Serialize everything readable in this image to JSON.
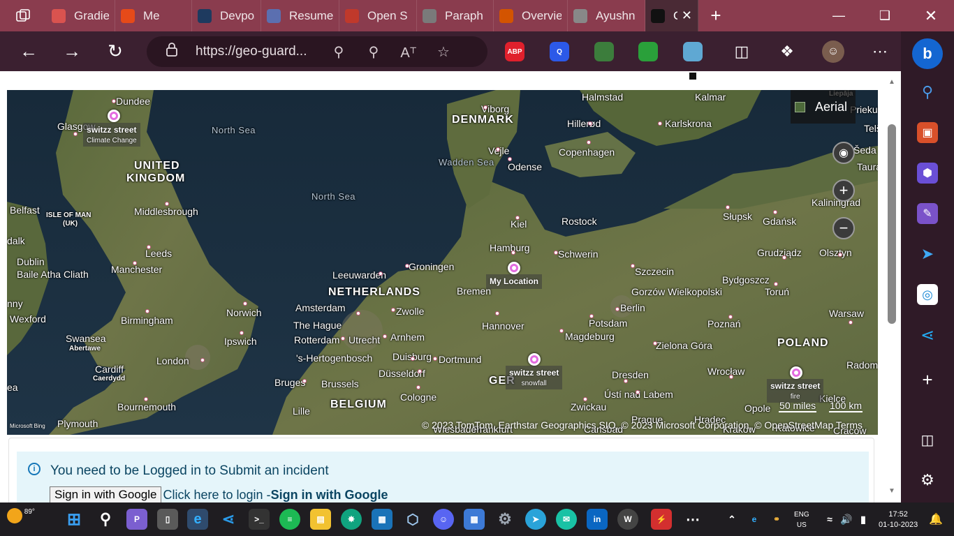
{
  "browser": {
    "tabs": [
      {
        "title": "Gradien",
        "color": "#d9534f"
      },
      {
        "title": "Me",
        "color": "#e64a19"
      },
      {
        "title": "Devpos",
        "color": "#1e3a5f"
      },
      {
        "title": "Resume",
        "color": "#5b6fb0"
      },
      {
        "title": "Open S",
        "color": "#c0392b"
      },
      {
        "title": "Paraph",
        "color": "#7a7a7a"
      },
      {
        "title": "Overvie",
        "color": "#d35400"
      },
      {
        "title": "Ayushn",
        "color": "#888888"
      },
      {
        "title": "Cre",
        "color": "#111111",
        "active": true
      }
    ],
    "address": {
      "url": "https://geo-guard..."
    },
    "extensions": [
      {
        "label": "ABP",
        "color": "#e0202c"
      },
      {
        "label": "Q",
        "color": "#2c59e8"
      },
      {
        "label": "",
        "color": "#3c7d3c"
      },
      {
        "label": "",
        "color": "#2aa03a"
      },
      {
        "label": "",
        "color": "#5fa8d3"
      }
    ]
  },
  "map": {
    "toggle_label": "Aerial",
    "attribution": "© 2023 TomTom, Earthstar Geographics SIO, © 2023 Microsoft Corporation, © OpenStreetMap  Terms",
    "scale_miles": "50 miles",
    "scale_km": "100 km",
    "provider": "Microsoft Bing",
    "countries": [
      "UNITED",
      "KINGDOM",
      "DENMARK",
      "NETHERLANDS",
      "BELGIUM",
      "POLAND",
      "GER"
    ],
    "seas": [
      "North Sea",
      "North Sea",
      "Wadden Sea"
    ],
    "pins": [
      {
        "title": "switzz street",
        "subtitle": "Climate Change"
      },
      {
        "title": "My Location",
        "subtitle": ""
      },
      {
        "title": "switzz street",
        "subtitle": "snowfall"
      },
      {
        "title": "switzz street",
        "subtitle": "fire"
      }
    ],
    "cities": [
      "Dundee",
      "Glasgow",
      "Belfast",
      "ISLE OF MAN",
      "(UK)",
      "Middlesbrough",
      "Leeds",
      "Manchester",
      "Dublin",
      "Baile Atha Cliath",
      "Wexford",
      "Birmingham",
      "Swansea",
      "Abertawe",
      "Cardiff",
      "Caerdydd",
      "London",
      "Bournemouth",
      "Plymouth",
      "Norwich",
      "Ipswich",
      "Amsterdam",
      "The Hague",
      "Rotterdam",
      "Utrecht",
      "Arnhem",
      "Zwolle",
      "'s-Hertogenbosch",
      "Duisburg",
      "Düsseldorf",
      "Dortmund",
      "Bruges",
      "Brussels",
      "Cologne",
      "Lille",
      "Leeuwarden",
      "Groningen",
      "Bremen",
      "Hamburg",
      "Kiel",
      "Hannover",
      "Rostock",
      "Schwerin",
      "Odense",
      "Vejle",
      "Viborg",
      "Copenhagen",
      "Hillerød",
      "Halmstad",
      "Kalmar",
      "Karlskrona",
      "Szczecin",
      "Gorzów Wielkopolski",
      "Berlin",
      "Potsdam",
      "Magdeburg",
      "Zielona Góra",
      "Poznań",
      "Bydgoszcz",
      "Toruń",
      "Grudziądz",
      "Gdańsk",
      "Słupsk",
      "Olsztyn",
      "Kaliningrad",
      "Warsaw",
      "Wrocław",
      "Dresden",
      "Ústí nad Labem",
      "Zwickau",
      "Opole",
      "Kielce",
      "Radom",
      "Liepāja",
      "Priekule",
      "Telš",
      "Šeda",
      "Taura",
      "Frankfurt",
      "Wiesbaden",
      "Carlsbad",
      "Prague",
      "Hradec",
      "Katowice",
      "Kraków",
      "Cracow",
      "dalk",
      "nny",
      "ea"
    ]
  },
  "alert": {
    "message": "You need to be Logged in to Submit an incident",
    "button": "Sign in with Google",
    "link_text": "Click here to login - ",
    "bold_text": "Sign in with Google"
  },
  "taskbar": {
    "weather": "89°",
    "lang1": "ENG",
    "lang2": "US",
    "time": "17:52",
    "date": "01-10-2023"
  }
}
